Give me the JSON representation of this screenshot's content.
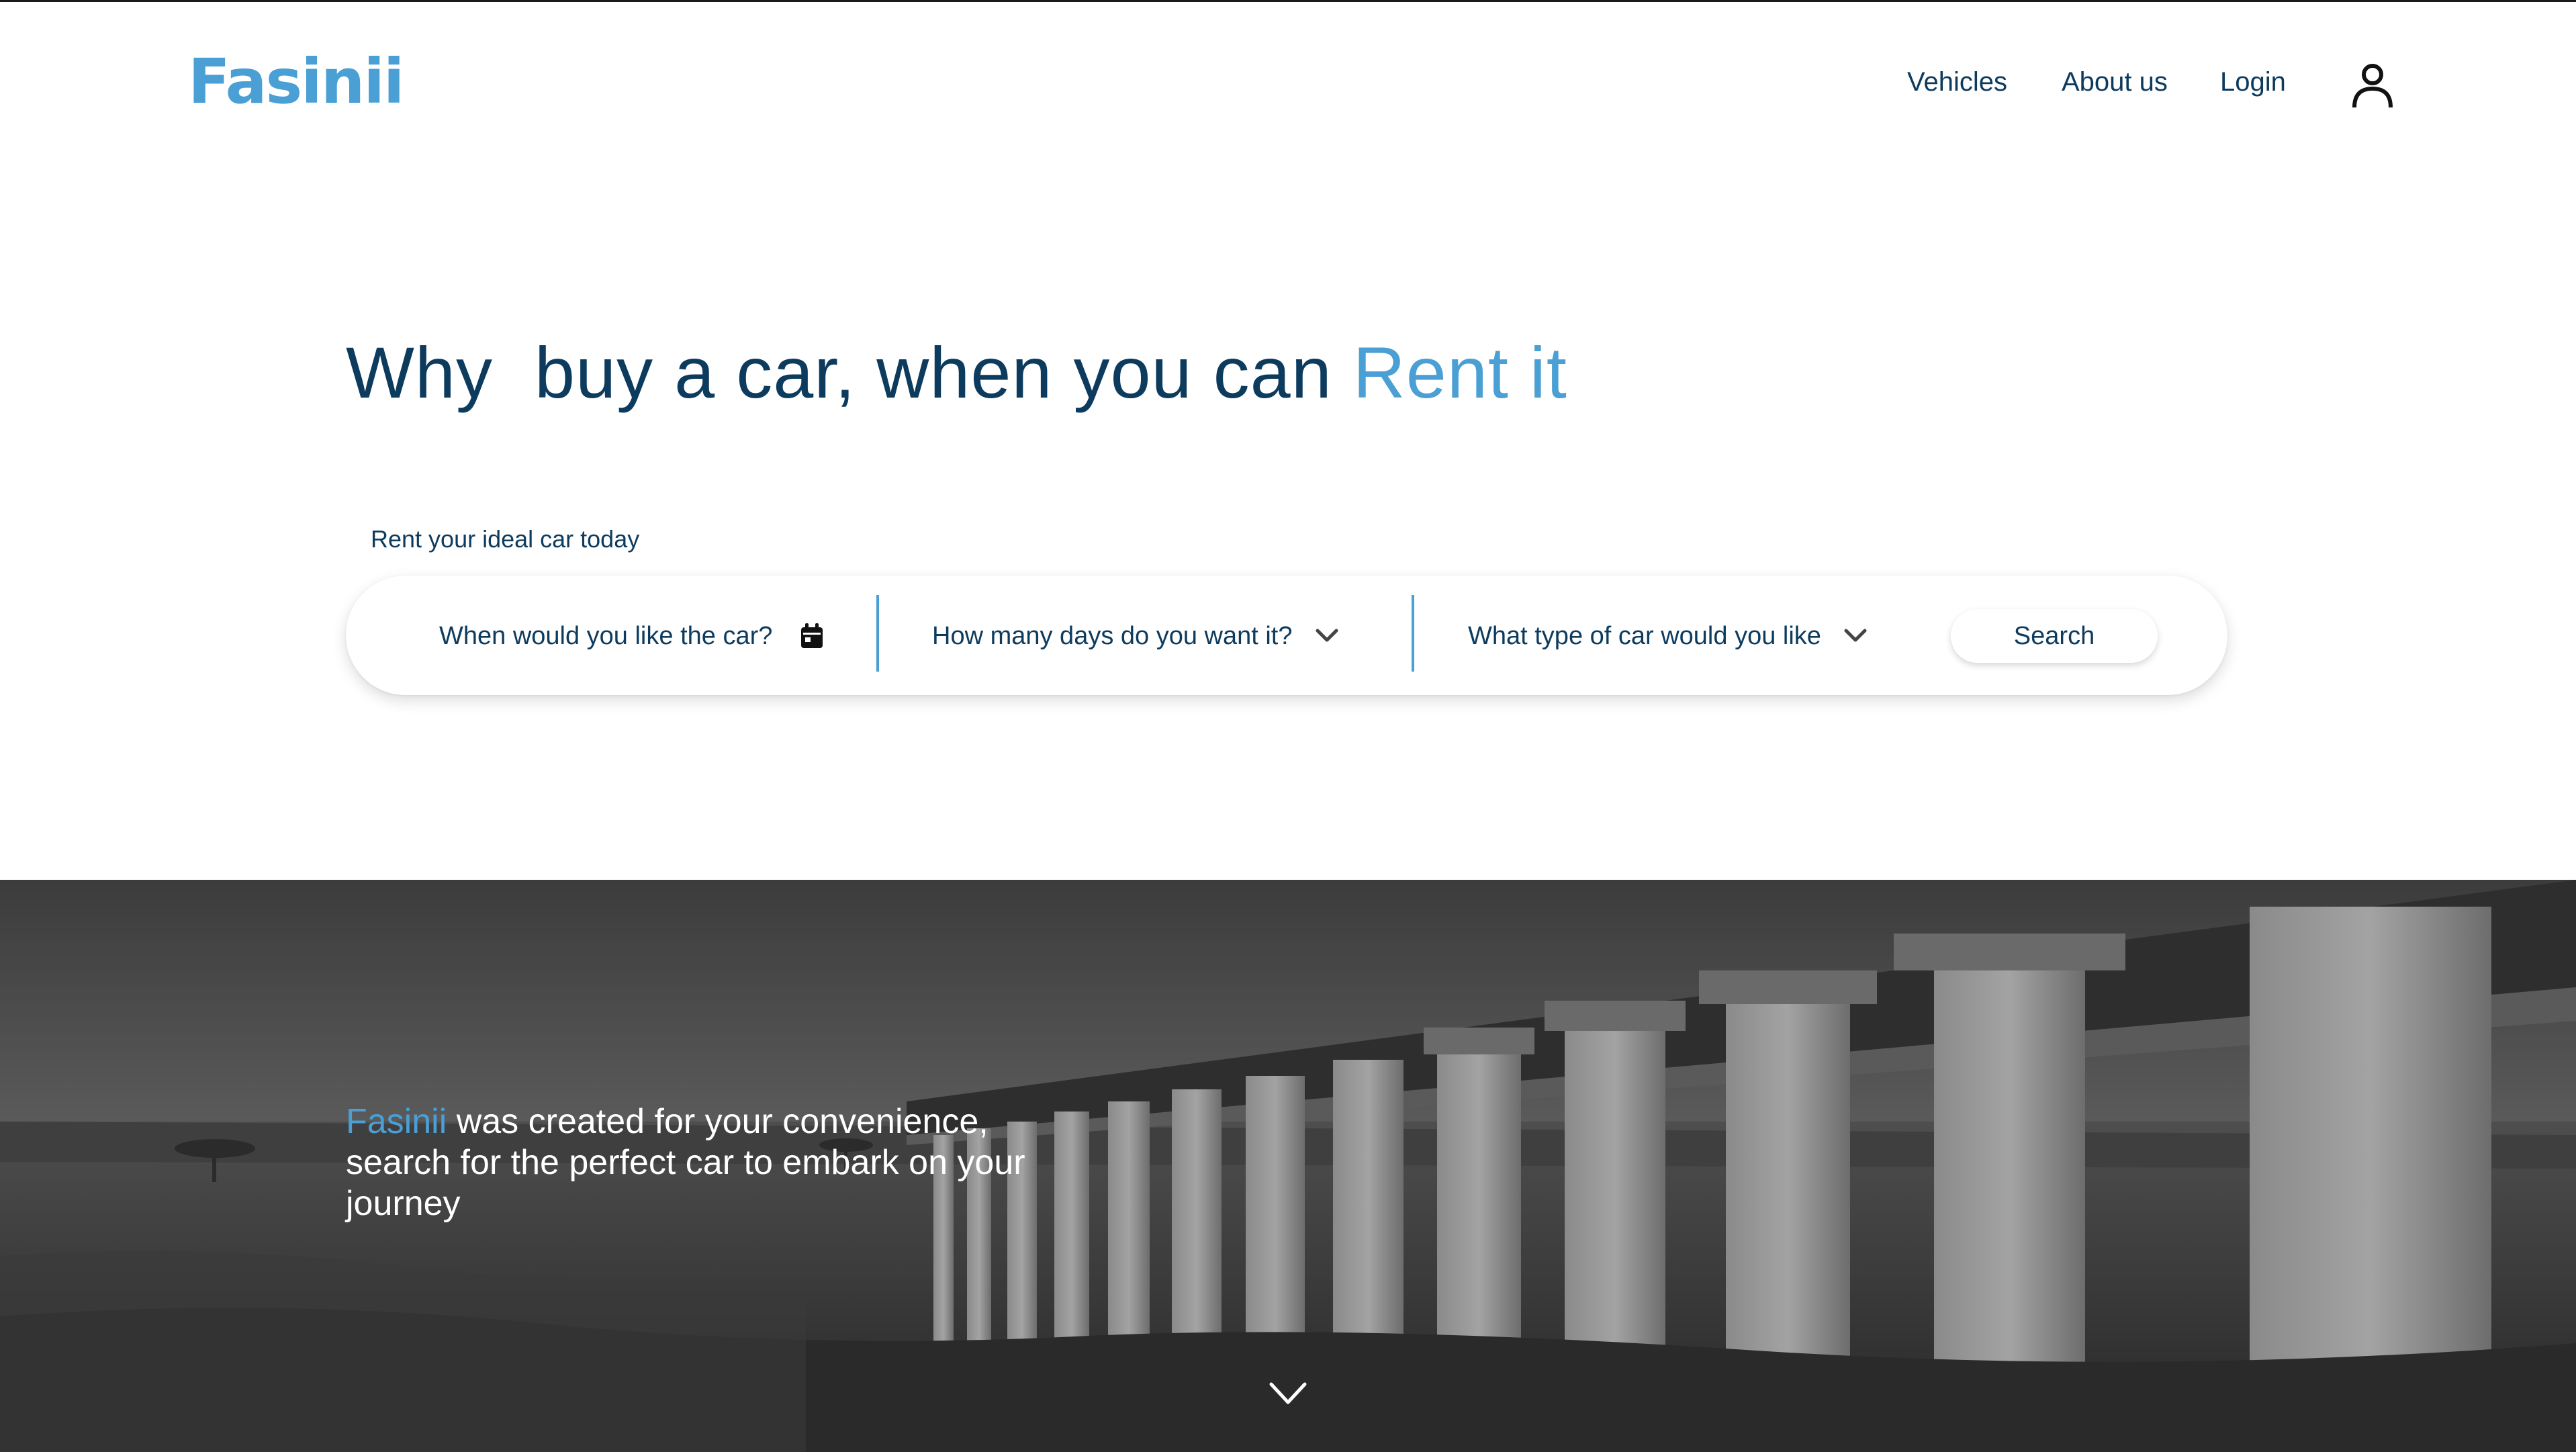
{
  "header": {
    "logo": "Fasinii",
    "nav": [
      {
        "label": "Vehicles"
      },
      {
        "label": "About us"
      },
      {
        "label": "Login"
      }
    ],
    "account_icon": "user-icon"
  },
  "hero": {
    "headline_main": "Why  buy a car, when you can ",
    "headline_accent": "Rent it",
    "subheading": "Rent your ideal car today",
    "search": {
      "date_placeholder": "When would you like the car?",
      "date_icon": "calendar-icon",
      "days_placeholder": "How many days do you want it?",
      "type_placeholder": "What type of car would you like",
      "button_label": "Search"
    }
  },
  "banner": {
    "brand": "Fasinii",
    "tagline_rest": " was created for your convenience, search for the perfect car to embark on your journey",
    "scroll_icon": "chevron-down-icon"
  },
  "colors": {
    "primary_text": "#0d3b5e",
    "accent": "#4a9fd4",
    "background": "#ffffff"
  }
}
